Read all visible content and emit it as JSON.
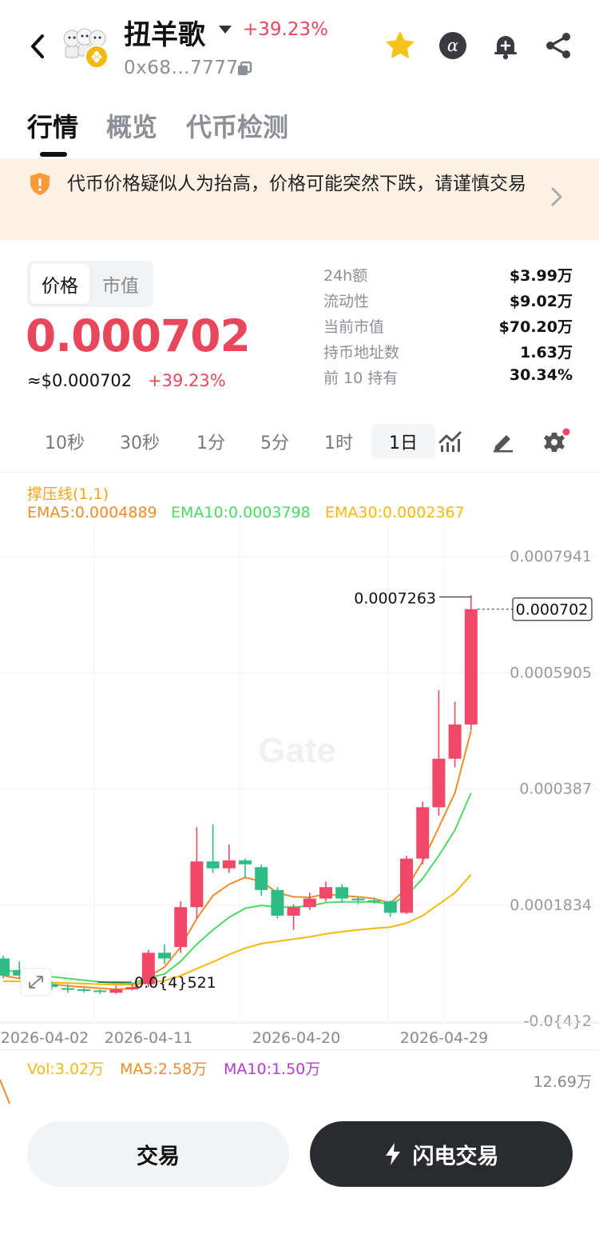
{
  "header": {
    "title": "扭羊歌",
    "change": "+39.23%",
    "address": "0x68...7777"
  },
  "tabs": [
    {
      "label": "行情",
      "active": true
    },
    {
      "label": "概览",
      "active": false
    },
    {
      "label": "代币检测",
      "active": false
    }
  ],
  "warning": {
    "text": "代币价格疑似人为抬高，价格可能突然下跌，请谨慎交易"
  },
  "price": {
    "toggle": [
      "价格",
      "市值"
    ],
    "value": "0.000702",
    "usd": "≈$0.000702",
    "change": "+39.23%"
  },
  "stats": [
    {
      "label": "24h额",
      "value": "$3.99万"
    },
    {
      "label": "流动性",
      "value": "$9.02万"
    },
    {
      "label": "当前市值",
      "value": "$70.20万"
    },
    {
      "label": "持币地址数",
      "value": "1.63万"
    },
    {
      "label": "前 10 持有",
      "value": "30.34%"
    }
  ],
  "intervals": [
    "10秒",
    "30秒",
    "1分",
    "5分",
    "1时",
    "1日"
  ],
  "indicators": {
    "sr": "撑压线(1,1)",
    "ema5": "EMA5:0.0004889",
    "ema10": "EMA10:0.0003798",
    "ema30": "EMA30:0.0002367"
  },
  "colors": {
    "up": "#f04866",
    "down": "#2ebd85",
    "ema5": "#f28c2a",
    "ema10": "#4cd964",
    "ema30": "#f2b90f",
    "accent_red": "#e8475b"
  },
  "chart_data": {
    "type": "candlestick",
    "y_ticks": [
      "0.0007941",
      "0.0005905",
      "0.000387",
      "0.0001834",
      "-0.0{4}2"
    ],
    "ylim": [
      -2e-05,
      0.0007941
    ],
    "x_ticks": [
      "2026-04-02",
      "2026-04-11",
      "2026-04-20",
      "2026-04-29"
    ],
    "high_label": "0.0007263",
    "low_label": "0.0{4}521",
    "last_price_label": "0.000702",
    "watermark": "Gate",
    "candles": [
      {
        "o": 9e-05,
        "c": 6e-05,
        "h": 9.5e-05,
        "l": 5.5e-05
      },
      {
        "o": 7e-05,
        "c": 6e-05,
        "h": 8.5e-05,
        "l": 5.5e-05
      },
      {
        "o": 5.5e-05,
        "c": 4.5e-05,
        "h": 6e-05,
        "l": 4e-05
      },
      {
        "o": 4.5e-05,
        "c": 4e-05,
        "h": 5e-05,
        "l": 3.5e-05
      },
      {
        "o": 3.8e-05,
        "c": 3.6e-05,
        "h": 4.5e-05,
        "l": 3e-05
      },
      {
        "o": 3.6e-05,
        "c": 3.4e-05,
        "h": 3.8e-05,
        "l": 3e-05
      },
      {
        "o": 3.4e-05,
        "c": 3.2e-05,
        "h": 3.6e-05,
        "l": 2.8e-05
      },
      {
        "o": 3e-05,
        "c": 3.6e-05,
        "h": 4.2e-05,
        "l": 2.8e-05
      },
      {
        "o": 3.6e-05,
        "c": 4e-05,
        "h": 4.6e-05,
        "l": 3.4e-05
      },
      {
        "o": 4.5e-05,
        "c": 0.0001,
        "h": 0.000105,
        "l": 4e-05
      },
      {
        "o": 0.0001,
        "c": 9e-05,
        "h": 0.000115,
        "l": 8e-05
      },
      {
        "o": 0.00011,
        "c": 0.00018,
        "h": 0.00019,
        "l": 0.0001
      },
      {
        "o": 0.00018,
        "c": 0.00026,
        "h": 0.00032,
        "l": 0.00016
      },
      {
        "o": 0.00026,
        "c": 0.000248,
        "h": 0.000325,
        "l": 0.00024
      },
      {
        "o": 0.000248,
        "c": 0.000262,
        "h": 0.00029,
        "l": 0.00024
      },
      {
        "o": 0.000262,
        "c": 0.000255,
        "h": 0.000265,
        "l": 0.00023
      },
      {
        "o": 0.00025,
        "c": 0.00021,
        "h": 0.000255,
        "l": 0.0002
      },
      {
        "o": 0.00021,
        "c": 0.000165,
        "h": 0.000215,
        "l": 0.00016
      },
      {
        "o": 0.000165,
        "c": 0.00018,
        "h": 0.000185,
        "l": 0.00014
      },
      {
        "o": 0.00018,
        "c": 0.000195,
        "h": 0.000205,
        "l": 0.000175
      },
      {
        "o": 0.000195,
        "c": 0.000215,
        "h": 0.000225,
        "l": 0.00019
      },
      {
        "o": 0.000215,
        "c": 0.000195,
        "h": 0.00022,
        "l": 0.000188
      },
      {
        "o": 0.000195,
        "c": 0.000192,
        "h": 0.000198,
        "l": 0.000185
      },
      {
        "o": 0.000192,
        "c": 0.00019,
        "h": 0.000196,
        "l": 0.000186
      },
      {
        "o": 0.00019,
        "c": 0.00017,
        "h": 0.000192,
        "l": 0.000163
      },
      {
        "o": 0.00017,
        "c": 0.000265,
        "h": 0.00027,
        "l": 0.000168
      },
      {
        "o": 0.000265,
        "c": 0.000355,
        "h": 0.000365,
        "l": 0.000255
      },
      {
        "o": 0.000355,
        "c": 0.00044,
        "h": 0.00056,
        "l": 0.00034
      },
      {
        "o": 0.00044,
        "c": 0.0005,
        "h": 0.00054,
        "l": 0.000425
      },
      {
        "o": 0.0005,
        "c": 0.000702,
        "h": 0.0007263,
        "l": 0.00049
      }
    ],
    "ema5": [
      6e-05,
      5.5e-05,
      5e-05,
      4.5e-05,
      4.2e-05,
      4e-05,
      3.8e-05,
      3.6e-05,
      3.7e-05,
      5.8e-05,
      7.5e-05,
      0.00011,
      0.00016,
      0.0002,
      0.00022,
      0.000232,
      0.000225,
      0.000205,
      0.000198,
      0.000197,
      0.000203,
      0.0002,
      0.000198,
      0.000195,
      0.000187,
      0.000213,
      0.00026,
      0.00032,
      0.00038,
      0.000489
    ],
    "ema10": [
      7e-05,
      6.6e-05,
      6.2e-05,
      5.8e-05,
      5.5e-05,
      5.2e-05,
      4.9e-05,
      4.7e-05,
      4.6e-05,
      5.6e-05,
      6.3e-05,
      8.5e-05,
      0.000115,
      0.00014,
      0.000162,
      0.000178,
      0.000183,
      0.00018,
      0.00018,
      0.000182,
      0.000188,
      0.000189,
      0.000189,
      0.000189,
      0.000185,
      0.0002,
      0.00023,
      0.00027,
      0.000315,
      0.00038
    ],
    "ema30": [
      5e-05,
      5e-05,
      4.9e-05,
      4.8e-05,
      4.7e-05,
      4.6e-05,
      4.5e-05,
      4.4e-05,
      4.4e-05,
      4.8e-05,
      5.1e-05,
      6e-05,
      7.2e-05,
      8.4e-05,
      9.7e-05,
      0.000108,
      0.000116,
      0.00012,
      0.000124,
      0.000128,
      0.000133,
      0.000137,
      0.00014,
      0.000143,
      0.000145,
      0.000152,
      0.000165,
      0.000185,
      0.000205,
      0.000237
    ]
  },
  "volume": {
    "vol": "Vol:3.02万",
    "ma5": "MA5:2.58万",
    "ma10": "MA10:1.50万",
    "max": "12.69万"
  },
  "buttons": {
    "trade": "交易",
    "flash": "闪电交易"
  }
}
